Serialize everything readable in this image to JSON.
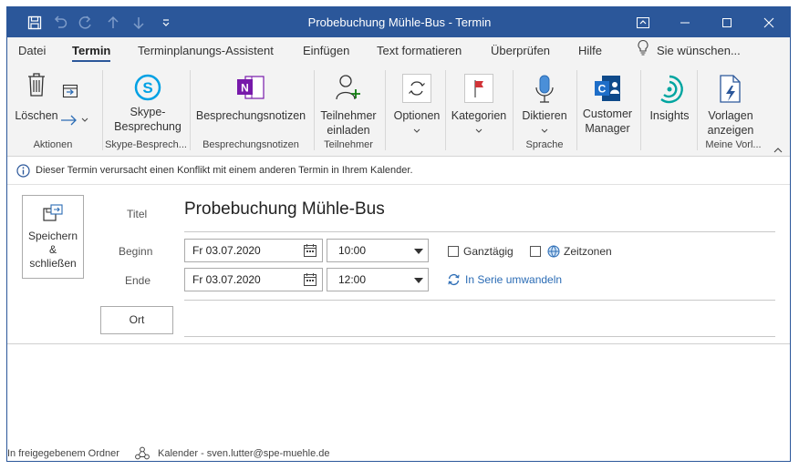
{
  "window": {
    "title": "Probebuchung Mühle-Bus  -  Termin"
  },
  "menu": {
    "tabs": [
      {
        "label": "Datei"
      },
      {
        "label": "Termin"
      },
      {
        "label": "Terminplanungs-Assistent"
      },
      {
        "label": "Einfügen"
      },
      {
        "label": "Text formatieren"
      },
      {
        "label": "Überprüfen"
      },
      {
        "label": "Hilfe"
      }
    ],
    "tell_me": "Sie wünschen..."
  },
  "ribbon": {
    "delete_label": "Löschen",
    "skype_label_1": "Skype-",
    "skype_label_2": "Besprechung",
    "notes_label": "Besprechungsnotizen",
    "invite_label_1": "Teilnehmer",
    "invite_label_2": "einladen",
    "options_label": "Optionen",
    "categories_label": "Kategorien",
    "dictate_label": "Diktieren",
    "customer_label_1": "Customer",
    "customer_label_2": "Manager",
    "insights_label": "Insights",
    "templates_label_1": "Vorlagen",
    "templates_label_2": "anzeigen",
    "groups": {
      "aktionen": "Aktionen",
      "skype": "Skype-Besprech...",
      "notes": "Besprechungsnotizen",
      "attendees": "Teilnehmer",
      "language": "Sprache",
      "templates": "Meine Vorl..."
    }
  },
  "info": {
    "message": "Dieser Termin verursacht einen Konflikt mit einem anderen Termin in Ihrem Kalender."
  },
  "form": {
    "save_close_1": "Speichern",
    "save_close_2": "&",
    "save_close_3": "schließen",
    "title_label": "Titel",
    "title_value": "Probebuchung Mühle-Bus",
    "start_label": "Beginn",
    "start_date": "Fr 03.07.2020",
    "start_time": "10:00",
    "end_label": "Ende",
    "end_date": "Fr 03.07.2020",
    "end_time": "12:00",
    "allday_label": "Ganztägig",
    "timezones_label": "Zeitzonen",
    "recurrence_label": "In Serie umwandeln",
    "location_button": "Ort"
  },
  "status": {
    "folder": "In freigegebenem Ordner",
    "calendar": "Kalender - sven.lutter@spe-muehle.de"
  },
  "colors": {
    "titlebar": "#2b579a",
    "ribbon_bg": "#f3f3f3",
    "link": "#2b6cb5"
  }
}
